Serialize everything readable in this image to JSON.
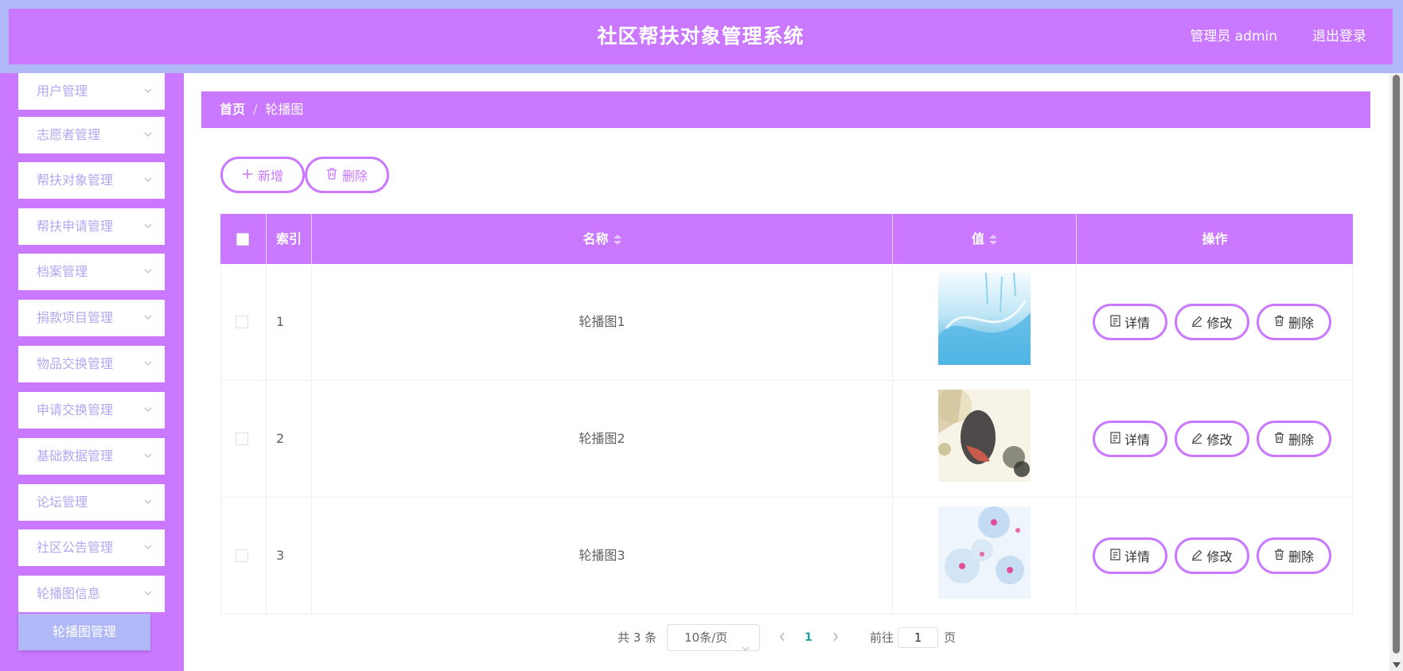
{
  "header": {
    "title": "社区帮扶对象管理系统",
    "user": "管理员 admin",
    "logout": "退出登录"
  },
  "sidebar": {
    "items": [
      {
        "label": "用户管理"
      },
      {
        "label": "志愿者管理"
      },
      {
        "label": "帮扶对象管理"
      },
      {
        "label": "帮扶申请管理"
      },
      {
        "label": "档案管理"
      },
      {
        "label": "捐款项目管理"
      },
      {
        "label": "物品交换管理"
      },
      {
        "label": "申请交换管理"
      },
      {
        "label": "基础数据管理"
      },
      {
        "label": "论坛管理"
      },
      {
        "label": "社区公告管理"
      },
      {
        "label": "轮播图信息"
      }
    ],
    "active_sub": "轮播图管理"
  },
  "breadcrumb": {
    "home": "首页",
    "separator": "/",
    "current": "轮播图"
  },
  "toolbar": {
    "add_label": "新增",
    "delete_label": "删除"
  },
  "table": {
    "columns": [
      "索引",
      "名称",
      "值",
      "操作"
    ],
    "rows": [
      {
        "index": "1",
        "name": "轮播图1",
        "image": "water-splash-image"
      },
      {
        "index": "2",
        "name": "轮播图2",
        "image": "flowers-image"
      },
      {
        "index": "3",
        "name": "轮播图3",
        "image": "blue-flowers-image"
      }
    ],
    "actions": {
      "detail": "详情",
      "edit": "修改",
      "delete": "删除"
    }
  },
  "pagination": {
    "total": "共 3 条",
    "page_size": "10条/页",
    "current_page": "1",
    "goto_label": "前往",
    "goto_value": "1",
    "page_unit": "页"
  },
  "colors": {
    "primary": "#c978ff",
    "secondary": "#b0b8f8",
    "menu_text": "#b4a6f2"
  }
}
